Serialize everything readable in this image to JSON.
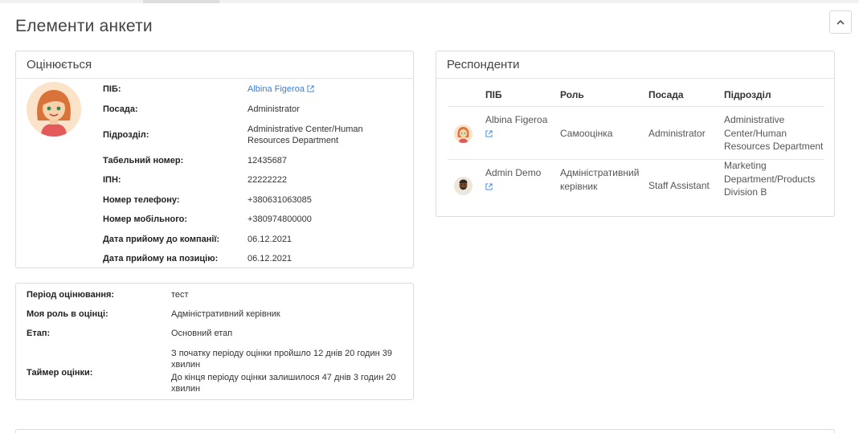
{
  "page": {
    "title": "Елементи анкети"
  },
  "evaluated": {
    "heading": "Оцінюється",
    "fields": [
      {
        "label": "ПІБ:",
        "value": "Albina Figeroa"
      },
      {
        "label": "Посада:",
        "value": "Administrator"
      },
      {
        "label": "Підрозділ:",
        "value": "Administrative Center/Human Resources Department"
      },
      {
        "label": "Табельний номер:",
        "value": "12435687"
      },
      {
        "label": "ІПН:",
        "value": "22222222"
      },
      {
        "label": "Номер телефону:",
        "value": "+380631063085"
      },
      {
        "label": "Номер мобільного:",
        "value": "+380974800000"
      },
      {
        "label": "Дата прийому до компанії:",
        "value": "06.12.2021"
      },
      {
        "label": "Дата прийому на позицію:",
        "value": "06.12.2021"
      }
    ]
  },
  "respondents": {
    "heading": "Респонденти",
    "columns": [
      "ПІБ",
      "Роль",
      "Посада",
      "Підрозділ"
    ],
    "rows": [
      {
        "name": "Albina Figeroa",
        "role": "Самооцінка",
        "position": "Administrator",
        "department": "Administrative Center/Human Resources Department",
        "avatar": "female-avatar"
      },
      {
        "name": "Admin Demo",
        "role": "Адміністративний керівник",
        "position": "Staff Assistant",
        "department": "Marketing Department/Products Division B",
        "avatar": "male-avatar"
      }
    ]
  },
  "period": {
    "fields": [
      {
        "label": "Період оцінювання:",
        "value": "тест"
      },
      {
        "label": "Моя роль в оцінці:",
        "value": "Адміністративний керівник"
      },
      {
        "label": "Етап:",
        "value": "Основний етап"
      },
      {
        "label": "Таймер оцінки:",
        "value": "З початку періоду оцінки пройшло 12 днів 20 годин 39 хвилин",
        "value2": "До кінця періоду оцінки залишилося 47 днів 3 годин 20 хвилин"
      }
    ]
  },
  "colors": {
    "link": "#3b7dd8",
    "border": "#dcdcdc",
    "avatar_bg": "#fbe3c9"
  },
  "icons": {
    "collapse": "chevron-up-icon",
    "external": "external-link-icon"
  }
}
